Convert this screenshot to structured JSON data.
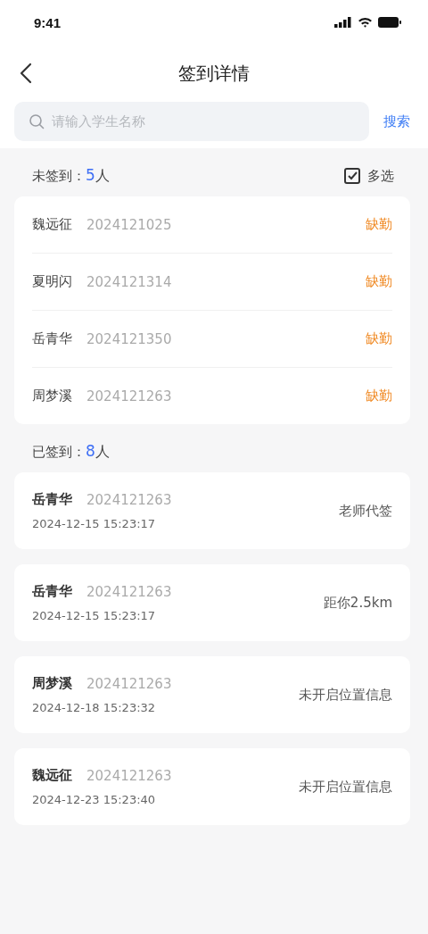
{
  "status_bar": {
    "time": "9:41"
  },
  "nav": {
    "title": "签到详情"
  },
  "search": {
    "placeholder": "请输入学生名称",
    "button": "搜索"
  },
  "absent": {
    "label": "未签到：",
    "count": "5",
    "unit": "人",
    "multi_select": "多选",
    "rows": [
      {
        "name": "魏远征",
        "id": "2024121025",
        "status": "缺勤"
      },
      {
        "name": "夏明闪",
        "id": "2024121314",
        "status": "缺勤"
      },
      {
        "name": "岳青华",
        "id": "2024121350",
        "status": "缺勤"
      },
      {
        "name": "周梦溪",
        "id": "2024121263",
        "status": "缺勤"
      }
    ]
  },
  "present": {
    "label": "已签到：",
    "count": "8",
    "unit": "人",
    "cards": [
      {
        "name": "岳青华",
        "id": "2024121263",
        "time": "2024-12-15 15:23:17",
        "note": "老师代签"
      },
      {
        "name": "岳青华",
        "id": "2024121263",
        "time": "2024-12-15 15:23:17",
        "note": "距你2.5km"
      },
      {
        "name": "周梦溪",
        "id": "2024121263",
        "time": "2024-12-18 15:23:32",
        "note": "未开启位置信息"
      },
      {
        "name": "魏远征",
        "id": "2024121263",
        "time": "2024-12-23 15:23:40",
        "note": "未开启位置信息"
      }
    ]
  }
}
